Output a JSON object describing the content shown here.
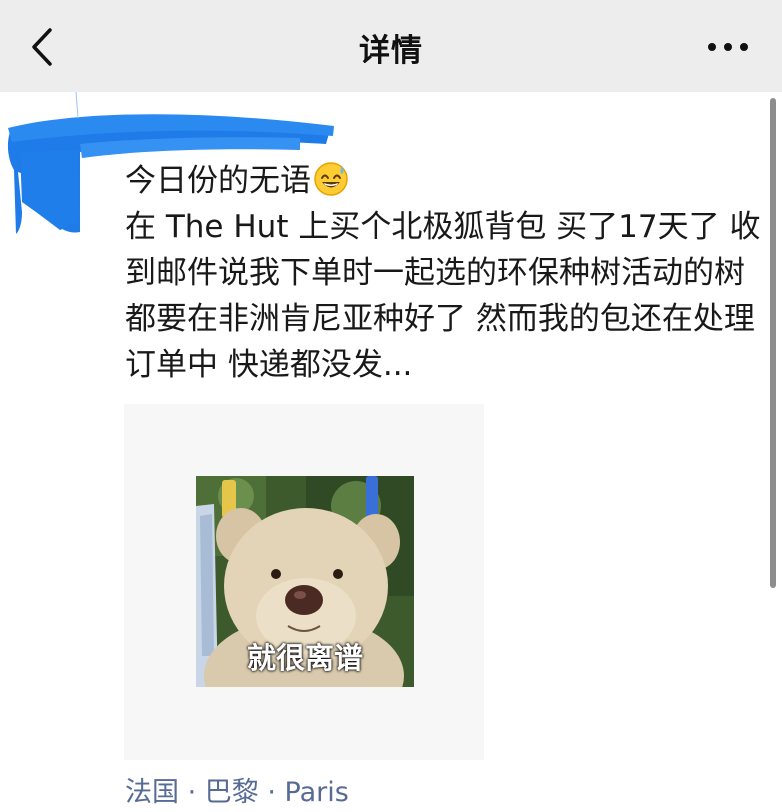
{
  "navbar": {
    "title": "详情",
    "back_icon": "chevron-left-icon",
    "more_icon": "more-dots-icon",
    "background": "#ededed"
  },
  "post": {
    "text_line_1": "今日份的无语",
    "emoji": "sweat-smile-emoji",
    "text_body": "在 The Hut 上买个北极狐背包 买了17天了 收到邮件说我下单时一起选的环保种树活动的树都要在非洲肯尼亚种好了 然而我的包还在处理订单中 快递都没发...",
    "sticker_caption": "就很离谱",
    "location": "法国 · 巴黎 · Paris"
  },
  "colors": {
    "link": "#576b95",
    "text": "#191919",
    "redaction": "#1e7be8"
  }
}
